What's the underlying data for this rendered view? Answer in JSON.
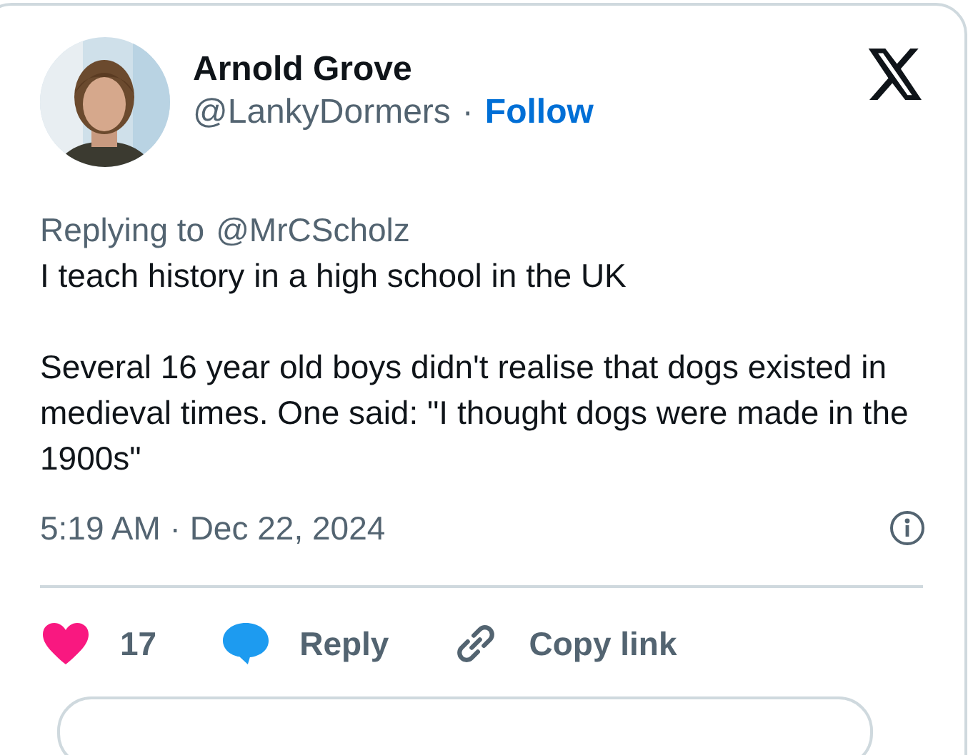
{
  "author": {
    "name": "Arnold Grove",
    "handle": "@LankyDormers",
    "separator": "·",
    "follow": "Follow"
  },
  "reply_context": {
    "prefix": "Replying to",
    "mention": "@MrCScholz"
  },
  "body": [
    "I teach history in a high school in the UK",
    "Several 16 year old boys didn't realise that dogs existed in medieval times. One said: \"I thought dogs were made in the 1900s\""
  ],
  "timestamp": "5:19 AM · Dec 22, 2024",
  "actions": [
    {
      "kind": "like",
      "label": "17"
    },
    {
      "kind": "reply",
      "label": "Reply"
    },
    {
      "kind": "copy",
      "label": "Copy link"
    }
  ]
}
